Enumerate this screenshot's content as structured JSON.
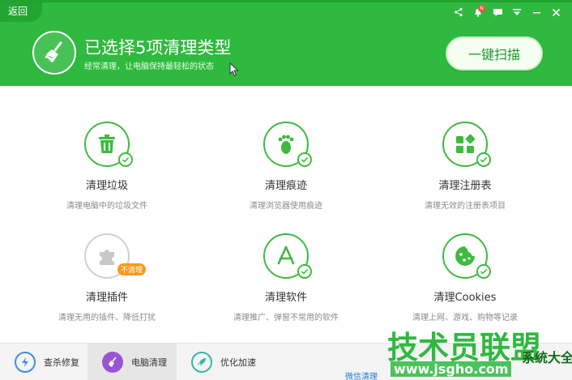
{
  "header": {
    "back_label": "返回",
    "title": "已选择5项清理类型",
    "subtitle": "经常清理，让电脑保持最轻松的状态",
    "scan_label": "一键扫描",
    "notify_badge": "N"
  },
  "items": [
    {
      "label": "清理垃圾",
      "desc": "清理电脑中的垃圾文件",
      "icon": "trash-icon",
      "selected": true
    },
    {
      "label": "清理痕迹",
      "desc": "清理浏览器使用痕迹",
      "icon": "footprint-icon",
      "selected": true
    },
    {
      "label": "清理注册表",
      "desc": "清理无效的注册表项目",
      "icon": "registry-icon",
      "selected": true
    },
    {
      "label": "清理插件",
      "desc": "清理无用的插件、降低打扰",
      "icon": "puzzle-icon",
      "selected": false,
      "badge": "不清理"
    },
    {
      "label": "清理软件",
      "desc": "清理推广、弹窗不常用的软件",
      "icon": "app-store-icon",
      "selected": true
    },
    {
      "label": "清理Cookies",
      "desc": "清理上网、游戏、购物等记录",
      "icon": "cookie-icon",
      "selected": true
    }
  ],
  "bottom": {
    "nav": [
      {
        "label": "查杀修复",
        "icon": "shield-bolt-icon"
      },
      {
        "label": "电脑清理",
        "icon": "broom-icon"
      },
      {
        "label": "优化加速",
        "icon": "rocket-icon"
      }
    ],
    "wechat": "微信清理"
  },
  "watermark": {
    "big": "技术员联盟",
    "small": "www.jsgho.com",
    "logo": "系统大全"
  },
  "colors": {
    "header_green": "#2fb93f",
    "accent_green": "#3dbb3f",
    "badge_orange": "#f79a1b"
  }
}
